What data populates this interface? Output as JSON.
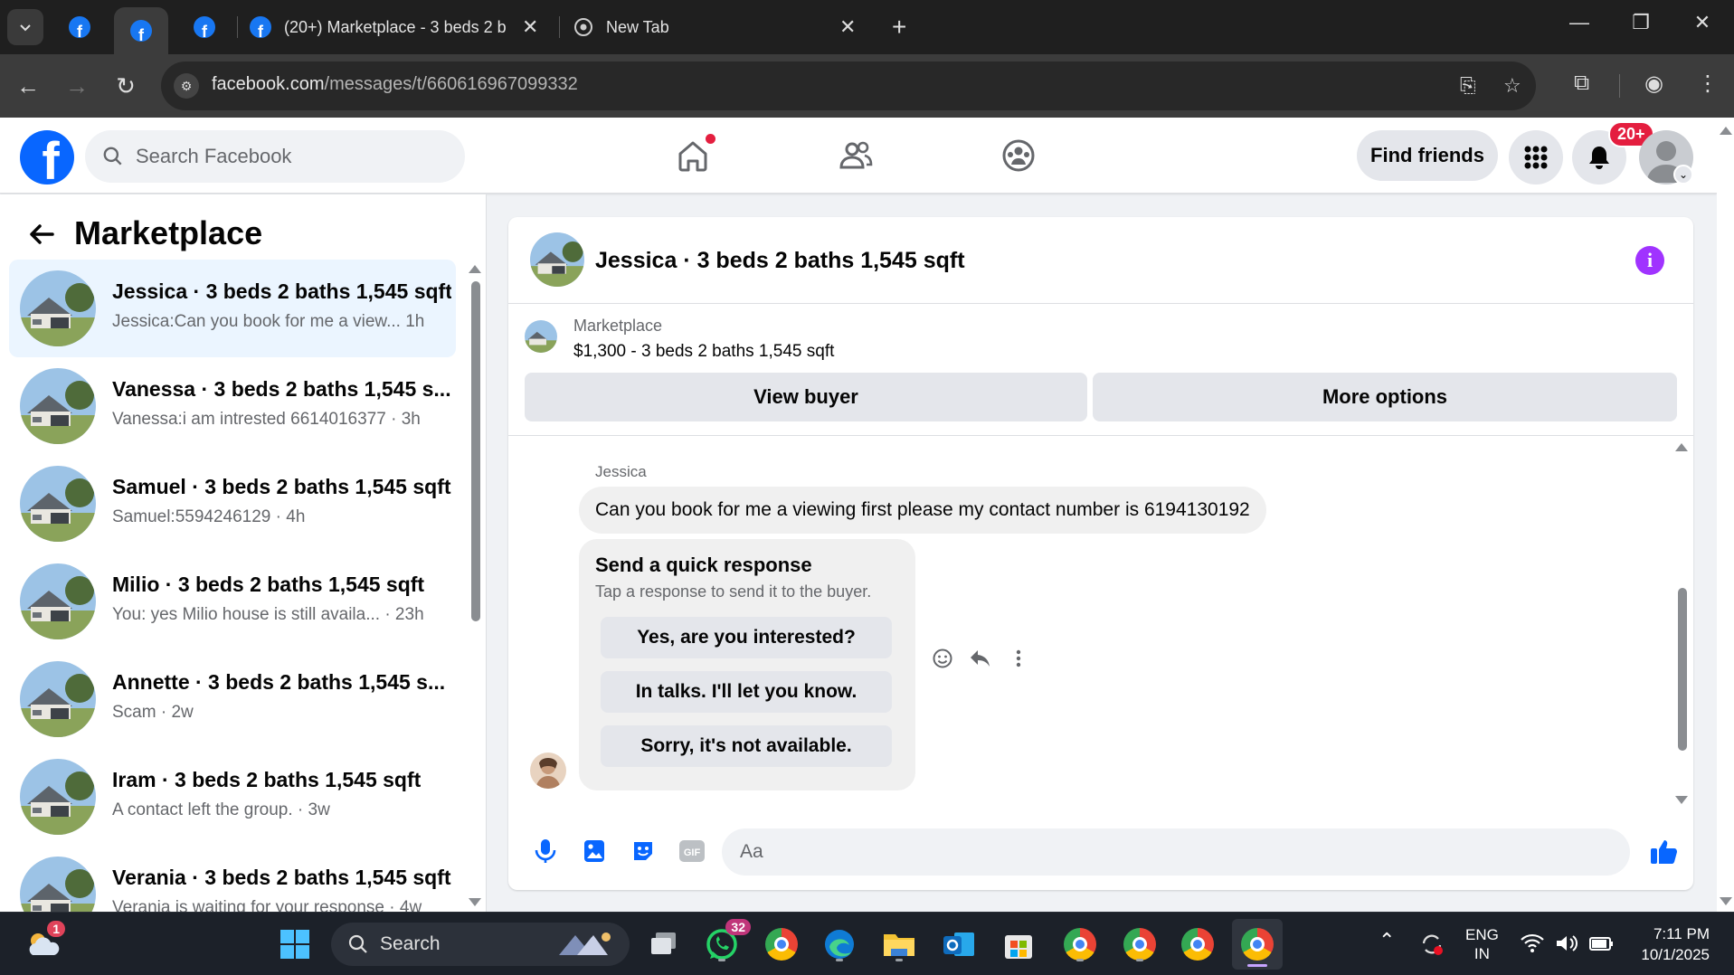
{
  "browser": {
    "active_tab_title": "(20+) Marketplace - 3 beds 2 b",
    "new_tab_title": "New Tab",
    "url_host": "facebook.com",
    "url_path": "/messages/t/660616967099332"
  },
  "header": {
    "search_placeholder": "Search Facebook",
    "find_friends": "Find friends",
    "notifications_badge": "20+"
  },
  "sidebar": {
    "title": "Marketplace",
    "conversations": [
      {
        "name": "Jessica · 3 beds 2 baths 1,545 sqft",
        "snippet": "Jessica:Can you book for me a view...  1h"
      },
      {
        "name": "Vanessa · 3 beds 2 baths 1,545 s...",
        "snippet": "Vanessa:i am intrested 6614016377 · 3h"
      },
      {
        "name": "Samuel · 3 beds 2 baths 1,545 sqft",
        "snippet": "Samuel:5594246129 · 4h"
      },
      {
        "name": "Milio · 3 beds 2 baths 1,545 sqft",
        "snippet": "You: yes Milio house is still availa...  · 23h"
      },
      {
        "name": "Annette · 3 beds 2 baths 1,545 s...",
        "snippet": "Scam · 2w"
      },
      {
        "name": "Iram · 3 beds 2 baths 1,545 sqft",
        "snippet": "A contact left the group. · 3w"
      },
      {
        "name": "Verania · 3 beds 2 baths 1,545 sqft",
        "snippet": "Verania is waiting for your response · 4w"
      }
    ]
  },
  "chat": {
    "title": "Jessica · 3 beds 2 baths 1,545 sqft",
    "listing_source": "Marketplace",
    "listing_price": "$1,300 - 3 beds 2 baths 1,545 sqft",
    "view_buyer": "View buyer",
    "more_options": "More options",
    "sender": "Jessica",
    "message": "Can you book for me a viewing first please my contact number is 6194130192",
    "quick_title": "Send a quick response",
    "quick_sub": "Tap a response to send it to the buyer.",
    "quick_replies": [
      "Yes, are you interested?",
      "In talks. I'll let you know.",
      "Sorry, it's not available."
    ],
    "composer_placeholder": "Aa"
  },
  "taskbar": {
    "search_placeholder": "Search",
    "weather_badge": "1",
    "whatsapp_badge": "32",
    "lang": "ENG",
    "region": "IN",
    "time": "7:11 PM",
    "date": "10/1/2025"
  },
  "colors": {
    "facebook_blue": "#0866ff",
    "notification_red": "#e41e3f",
    "info_purple": "#a033ff",
    "active_conversation": "#ebf5ff"
  }
}
